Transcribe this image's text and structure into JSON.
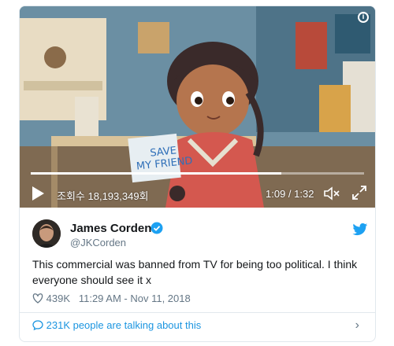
{
  "video": {
    "views_text": "조회수 18,193,349회",
    "time_text": "1:09 / 1:32",
    "progress_fraction": 0.7528,
    "sign_line1": "SAVE",
    "sign_line2": "MY FRIEND",
    "info_glyph": "i"
  },
  "tweet": {
    "author_name": "James Corden",
    "author_handle": "@JKCorden",
    "text": "This commercial was banned from TV for being too political. I think everyone should see it x",
    "likes": "439K",
    "timestamp": "11:29 AM - Nov 11, 2018",
    "talking_text": "231K people are talking about this",
    "chevron": "›"
  },
  "colors": {
    "link_blue": "#1b95e0",
    "verified_blue": "#1da1f2",
    "muted_text": "#657786",
    "border": "#e1e8ed"
  },
  "icons": [
    "info-icon",
    "play-icon",
    "mute-icon",
    "fullscreen-icon",
    "verified-icon",
    "twitter-icon",
    "heart-icon",
    "speech-bubble-icon",
    "chevron-right-icon"
  ]
}
